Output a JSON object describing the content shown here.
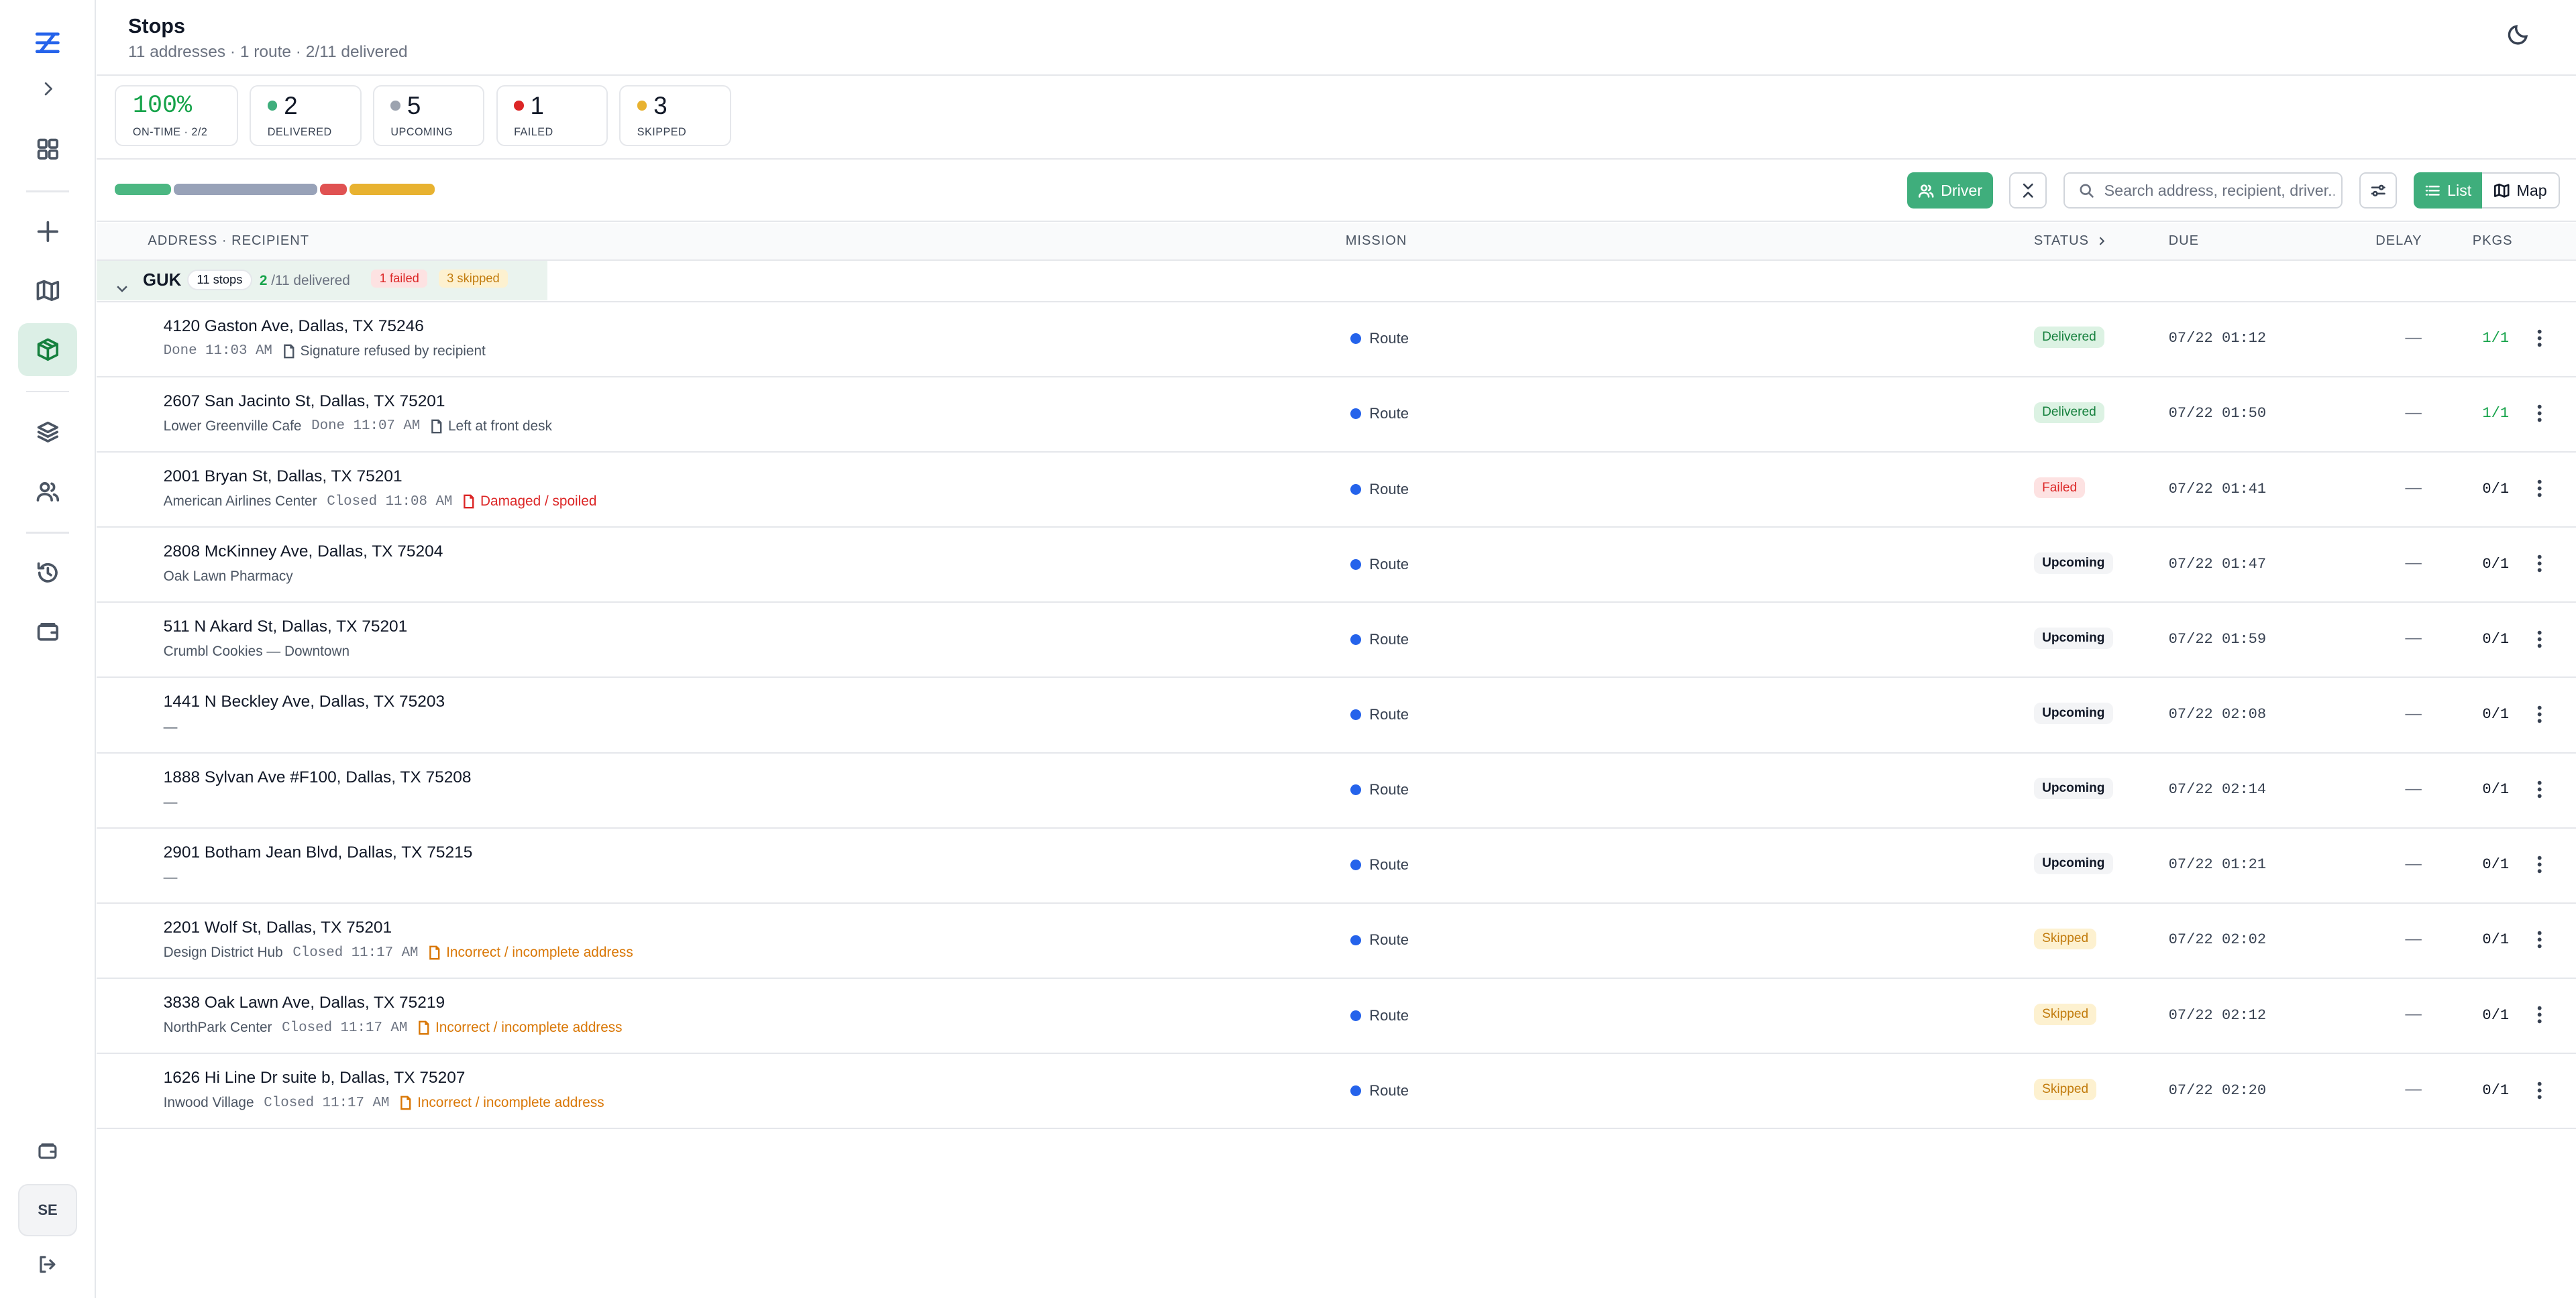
{
  "sidebar": {
    "icons": [
      "logo-icon",
      "chevron-right-icon",
      "dashboard-icon",
      "plus-icon",
      "map-icon",
      "package-icon",
      "layers-icon",
      "users-icon",
      "history-icon",
      "wallet-icon",
      "wallet-icon",
      "logout-icon"
    ],
    "avatar": "SE"
  },
  "header": {
    "title": "Stops",
    "subtitle": "11 addresses · 1 route · 2/11 delivered"
  },
  "stats": [
    {
      "value": "100%",
      "label": "ON-TIME · 2/2",
      "color": "#16a34a"
    },
    {
      "value": "2",
      "label": "DELIVERED",
      "color": "#3fae7c"
    },
    {
      "value": "5",
      "label": "UPCOMING",
      "color": "#9ca3af"
    },
    {
      "value": "1",
      "label": "FAILED",
      "color": "#dc2626"
    },
    {
      "value": "3",
      "label": "SKIPPED",
      "color": "#e8b230"
    }
  ],
  "progress": {
    "delivered": 2,
    "upcoming": 5,
    "failed": 1,
    "skipped": 3,
    "total": 11,
    "colors": {
      "delivered": "#4cb782",
      "upcoming": "#98a2b8",
      "failed": "#e05252",
      "skipped": "#e8b230"
    }
  },
  "toolbar": {
    "driver_label": "Driver",
    "search_placeholder": "Search address, recipient, driver...",
    "list_label": "List",
    "map_label": "Map"
  },
  "table": {
    "columns": {
      "address": "ADDRESS · RECIPIENT",
      "mission": "MISSION",
      "status": "STATUS",
      "due": "DUE",
      "delay": "DELAY",
      "pkgs": "PKGS"
    },
    "group": {
      "name": "GUK",
      "stops": "11 stops",
      "delivered": "2",
      "delivered_suffix": "/11 delivered",
      "failed": "1 failed",
      "skipped": "3 skipped"
    },
    "rows": [
      {
        "address": "4120 Gaston Ave, Dallas, TX 75246",
        "recipient": "",
        "time": "Done 11:03 AM",
        "note": "Signature refused by recipient",
        "note_tone": "gray",
        "mission": "Route",
        "status": "Delivered",
        "due": "07/22 01:12",
        "delay": "—",
        "pkgs": "1/1"
      },
      {
        "address": "2607 San Jacinto St, Dallas, TX 75201",
        "recipient": "Lower Greenville Cafe",
        "time": "Done 11:07 AM",
        "note": "Left at front desk",
        "note_tone": "gray",
        "mission": "Route",
        "status": "Delivered",
        "due": "07/22 01:50",
        "delay": "—",
        "pkgs": "1/1"
      },
      {
        "address": "2001 Bryan St, Dallas, TX 75201",
        "recipient": "American Airlines Center",
        "time": "Closed 11:08 AM",
        "note": "Damaged / spoiled",
        "note_tone": "red",
        "mission": "Route",
        "status": "Failed",
        "due": "07/22 01:41",
        "delay": "—",
        "pkgs": "0/1"
      },
      {
        "address": "2808 McKinney Ave, Dallas, TX 75204",
        "recipient": "Oak Lawn Pharmacy",
        "time": "",
        "note": "",
        "note_tone": "",
        "mission": "Route",
        "status": "Upcoming",
        "due": "07/22 01:47",
        "delay": "—",
        "pkgs": "0/1"
      },
      {
        "address": "511 N Akard St, Dallas, TX 75201",
        "recipient": "Crumbl Cookies — Downtown",
        "time": "",
        "note": "",
        "note_tone": "",
        "mission": "Route",
        "status": "Upcoming",
        "due": "07/22 01:59",
        "delay": "—",
        "pkgs": "0/1"
      },
      {
        "address": "1441 N Beckley Ave, Dallas, TX 75203",
        "recipient": "—",
        "time": "",
        "note": "",
        "note_tone": "",
        "mission": "Route",
        "status": "Upcoming",
        "due": "07/22 02:08",
        "delay": "—",
        "pkgs": "0/1"
      },
      {
        "address": "1888 Sylvan Ave #F100, Dallas, TX 75208",
        "recipient": "—",
        "time": "",
        "note": "",
        "note_tone": "",
        "mission": "Route",
        "status": "Upcoming",
        "due": "07/22 02:14",
        "delay": "—",
        "pkgs": "0/1"
      },
      {
        "address": "2901 Botham Jean Blvd, Dallas, TX 75215",
        "recipient": "—",
        "time": "",
        "note": "",
        "note_tone": "",
        "mission": "Route",
        "status": "Upcoming",
        "due": "07/22 01:21",
        "delay": "—",
        "pkgs": "0/1"
      },
      {
        "address": "2201 Wolf St, Dallas, TX 75201",
        "recipient": "Design District Hub",
        "time": "Closed 11:17 AM",
        "note": "Incorrect / incomplete address",
        "note_tone": "amber",
        "mission": "Route",
        "status": "Skipped",
        "due": "07/22 02:02",
        "delay": "—",
        "pkgs": "0/1"
      },
      {
        "address": "3838 Oak Lawn Ave, Dallas, TX 75219",
        "recipient": "NorthPark Center",
        "time": "Closed 11:17 AM",
        "note": "Incorrect / incomplete address",
        "note_tone": "amber",
        "mission": "Route",
        "status": "Skipped",
        "due": "07/22 02:12",
        "delay": "—",
        "pkgs": "0/1"
      },
      {
        "address": "1626 Hi Line Dr suite b, Dallas, TX 75207",
        "recipient": "Inwood Village",
        "time": "Closed 11:17 AM",
        "note": "Incorrect / incomplete address",
        "note_tone": "amber",
        "mission": "Route",
        "status": "Skipped",
        "due": "07/22 02:20",
        "delay": "—",
        "pkgs": "0/1"
      }
    ]
  }
}
